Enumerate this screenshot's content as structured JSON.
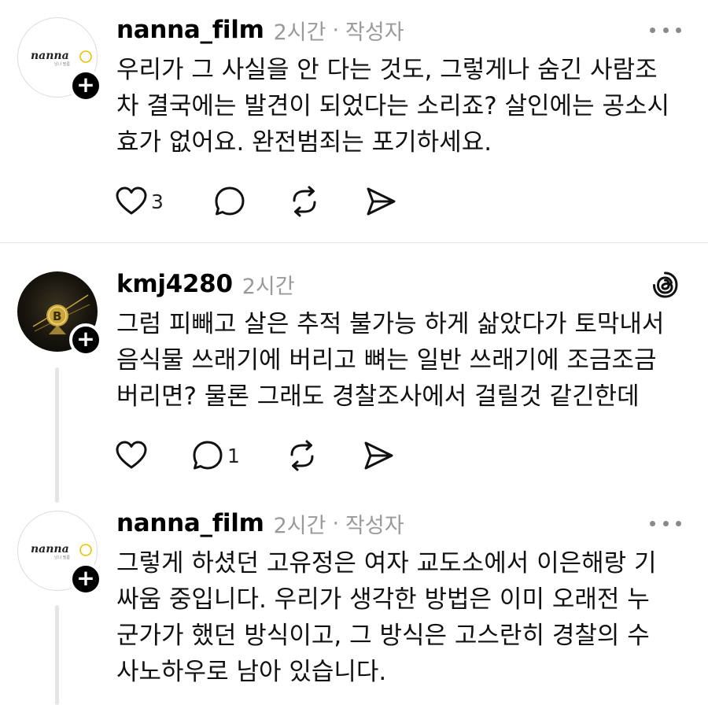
{
  "posts": [
    {
      "username": "nanna_film",
      "time": "2시간",
      "author_badge": "작성자",
      "avatar_logo": "nanna",
      "avatar_sub": "낭나 필름",
      "lines": [
        "우리가 그 사실을 안 다는 것도, 그렇게나 숨긴 사람조",
        "차 결국에는 발견이 되었다는 소리죠? 살인에는 공소시",
        "효가 없어요. 완전범죄는 포기하세요."
      ],
      "like_count": "3",
      "reply_count": ""
    },
    {
      "username": "kmj4280",
      "time": "2시간",
      "lines": [
        "그럼 피빼고 살은 추적 불가능 하게 삶았다가 토막내서",
        "음식물 쓰래기에 버리고 뼈는 일반 쓰래기에 조금조금",
        "버리면? 물론 그래도 경찰조사에서 걸릴것 같긴한데"
      ],
      "like_count": "",
      "reply_count": "1"
    },
    {
      "username": "nanna_film",
      "time": "2시간",
      "author_badge": "작성자",
      "avatar_logo": "nanna",
      "avatar_sub": "낭나 필름",
      "lines": [
        "그렇게 하셨던 고유정은 여자 교도소에서 이은해랑 기",
        "싸움 중입니다. 우리가 생각한 방법은 이미 오래전 누",
        "군가가 했던 방식이고, 그 방식은 고스란히 경찰의 수",
        "사노하우로 남아 있습니다."
      ]
    }
  ],
  "separator": "·",
  "plus_symbol": "+",
  "icons": [
    "heart-icon",
    "comment-icon",
    "repost-icon",
    "share-icon",
    "more-icon",
    "threads-logo-icon"
  ],
  "colors": {
    "meta": "#9a9a9a",
    "divider": "#e6e6e6",
    "text": "#111111"
  }
}
